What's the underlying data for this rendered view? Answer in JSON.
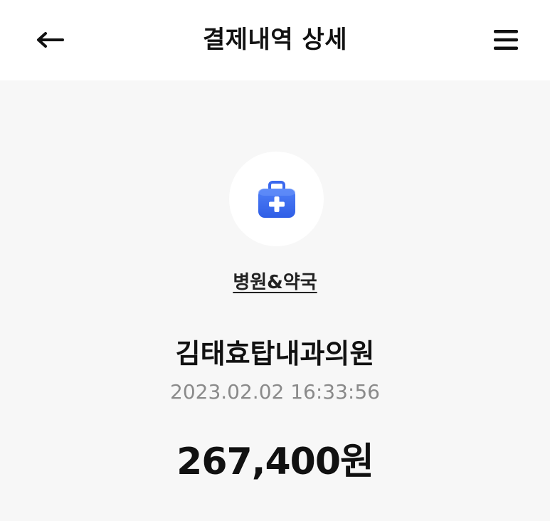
{
  "header": {
    "title": "결제내역 상세",
    "back_icon": "arrow-left-icon",
    "menu_icon": "hamburger-menu-icon"
  },
  "category": {
    "icon": "medical-kit-icon",
    "icon_color": "#3c6cf0",
    "label": "병원&약국"
  },
  "transaction": {
    "merchant": "김태효탑내과의원",
    "datetime": "2023.02.02 16:33:56",
    "amount": "267,400원"
  }
}
